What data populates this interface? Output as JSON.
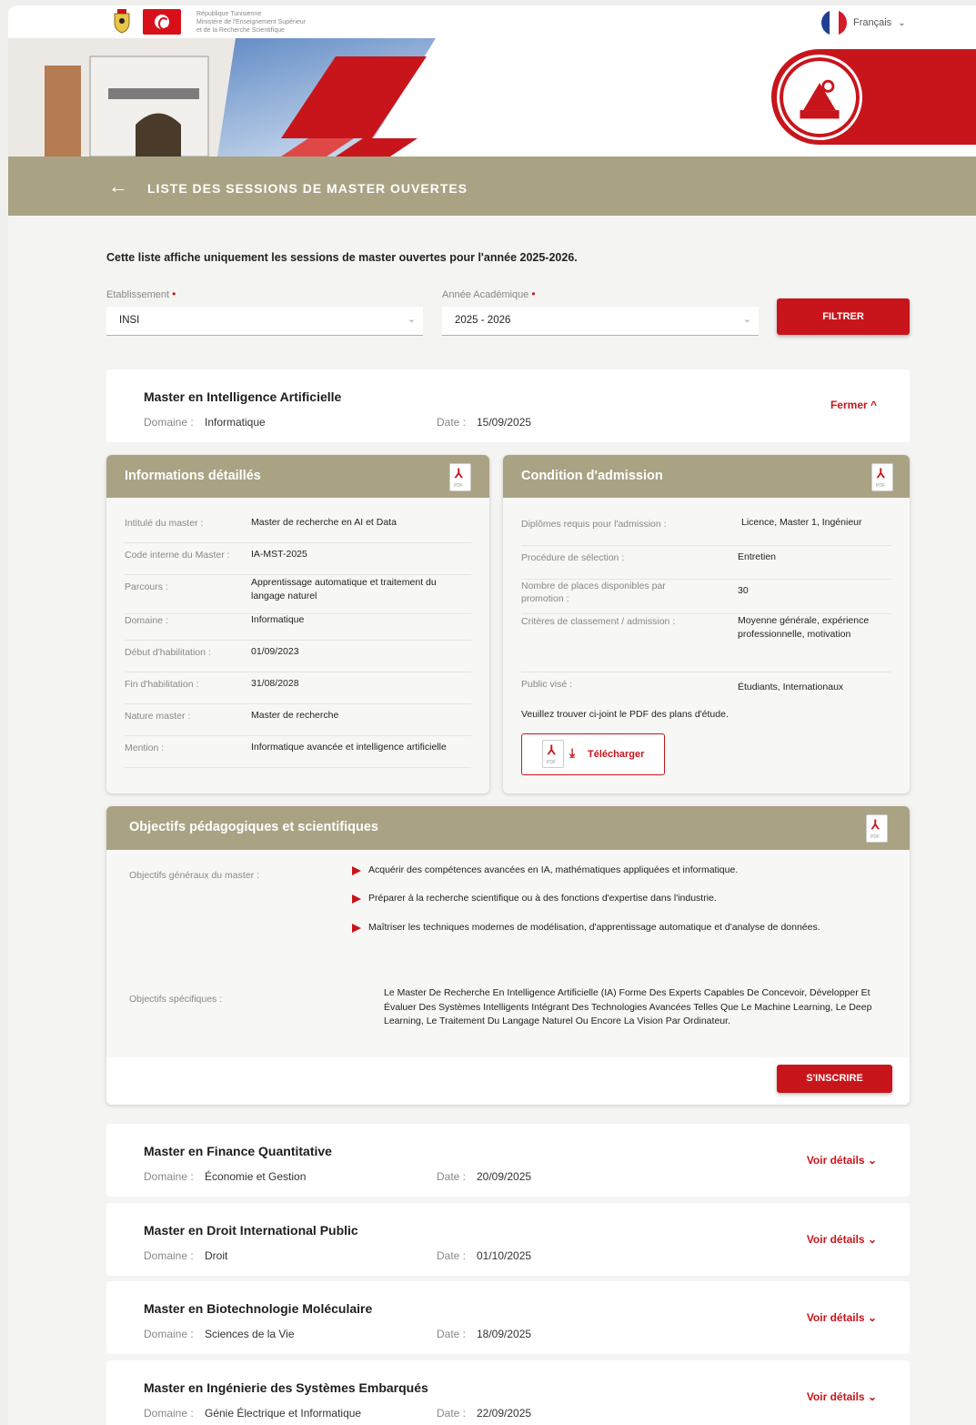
{
  "header": {
    "ministry_lines": [
      "République Tunisienne",
      "Ministère de l'Enseignement Supérieur",
      "et de la Recherche Scientifique"
    ],
    "language": "Français"
  },
  "page_title": "LISTE DES SESSIONS DE MASTER OUVERTES",
  "intro": "Cette liste affiche uniquement les sessions de master ouvertes pour l'année 2025-2026.",
  "filters": {
    "etablissement_label": "Etablissement",
    "etablissement_value": "INSI",
    "annee_label": "Année Académique",
    "annee_value": "2025 - 2026",
    "filter_button": "FILTRER"
  },
  "labels": {
    "domaine": "Domaine :",
    "date": "Date :"
  },
  "expanded": {
    "title": "Master en Intelligence Artificielle",
    "domaine": "Informatique",
    "date": "15/09/2025",
    "toggle": "Fermer ^"
  },
  "info_panel": {
    "title": "Informations détaillés",
    "rows": [
      {
        "k": "Intitulé du master :",
        "v": "Master de recherche en AI et Data"
      },
      {
        "k": "Code interne du Master :",
        "v": "IA-MST-2025"
      },
      {
        "k": "Parcours :",
        "v": "Apprentissage automatique et traitement du langage naturel"
      },
      {
        "k": "Domaine :",
        "v": "Informatique"
      },
      {
        "k": "Début d'habilitation :",
        "v": "01/09/2023"
      },
      {
        "k": "Fin d'habilitation :",
        "v": "31/08/2028"
      },
      {
        "k": "Nature master :",
        "v": "Master de recherche"
      },
      {
        "k": "Mention :",
        "v": "Informatique avancée et intelligence artificielle"
      }
    ]
  },
  "admission_panel": {
    "title": "Condition d'admission",
    "rows": [
      {
        "k": "Diplômes requis pour l'admission :",
        "v": "Licence, Master 1, Ingénieur"
      },
      {
        "k": "Procédure de sélection :",
        "v": "Entretien"
      },
      {
        "k": "Nombre de places disponibles par promotion :",
        "v": "30"
      },
      {
        "k": "Critères de classement / admission :",
        "v": "Moyenne générale, expérience professionnelle, motivation"
      },
      {
        "k": "Public visé :",
        "v": "Étudiants, Internationaux"
      }
    ],
    "pdf_note": "Veuillez trouver ci-joint le PDF des plans d'étude.",
    "download": "Télécharger"
  },
  "objectives_panel": {
    "title": "Objectifs pédagogiques et scientifiques",
    "general_label": "Objectifs généraux du master :",
    "general": [
      "Acquérir des compétences avancées en IA, mathématiques appliquées et informatique.",
      "Préparer à la recherche scientifique ou à des fonctions d'expertise dans l'industrie.",
      "Maîtriser les techniques modernes de modélisation, d'apprentissage automatique et d'analyse de données."
    ],
    "specific_label": "Objectifs spécifiques :",
    "specific": "Le Master De Recherche En Intelligence Artificielle (IA) Forme Des Experts Capables De Concevoir, Développer Et Évaluer Des Systèmes Intelligents Intégrant Des Technologies Avancées Telles Que Le Machine Learning, Le Deep Learning, Le Traitement Du Langage Naturel Ou Encore La Vision Par Ordinateur.",
    "register": "S'INSCRIRE"
  },
  "masters": [
    {
      "title": "Master en Finance Quantitative",
      "domaine": "Économie et Gestion",
      "date": "20/09/2025",
      "toggle": "Voir détails ⌄"
    },
    {
      "title": "Master en Droit International Public",
      "domaine": "Droit",
      "date": "01/10/2025",
      "toggle": "Voir détails ⌄"
    },
    {
      "title": "Master en Biotechnologie Moléculaire",
      "domaine": "Sciences de la Vie",
      "date": "18/09/2025",
      "toggle": "Voir détails ⌄"
    },
    {
      "title": "Master en Ingénierie des Systèmes Embarqués",
      "domaine": "Génie Électrique et Informatique",
      "date": "22/09/2025",
      "toggle": "Voir détails ⌄"
    }
  ],
  "colors": {
    "accent": "#c8151b",
    "band": "#a9a384"
  }
}
